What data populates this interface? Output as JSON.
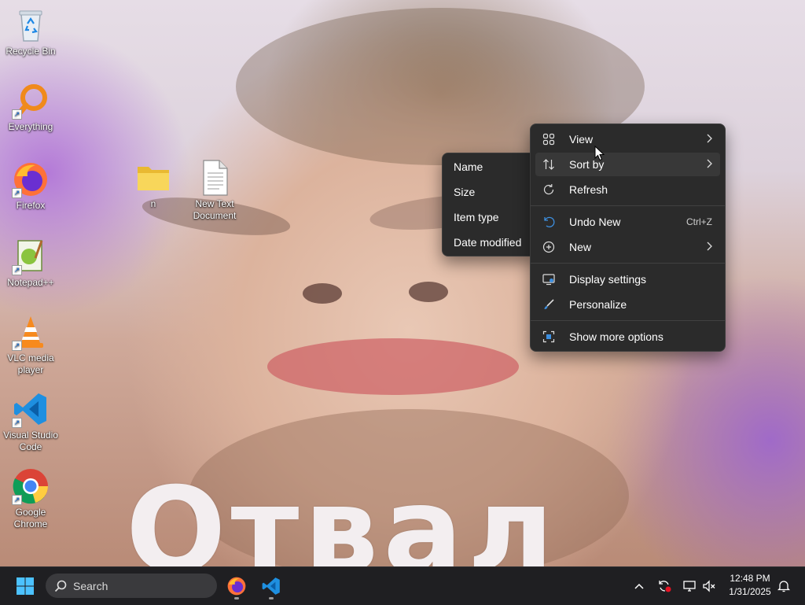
{
  "desktop": {
    "icons": [
      {
        "label": "Recycle Bin"
      },
      {
        "label": "Everything"
      },
      {
        "label": "Firefox"
      },
      {
        "label": "Notepad++"
      },
      {
        "label": "VLC media player"
      },
      {
        "label": "Visual Studio Code"
      },
      {
        "label": "Google Chrome"
      },
      {
        "label": "n"
      },
      {
        "label": "New Text Document"
      }
    ]
  },
  "wallpaper": {
    "caption": "Отвал"
  },
  "context_menu": {
    "items": {
      "view": "View",
      "sort_by": "Sort by",
      "refresh": "Refresh",
      "undo_new": "Undo New",
      "undo_shortcut": "Ctrl+Z",
      "new": "New",
      "display_settings": "Display settings",
      "personalize": "Personalize",
      "show_more": "Show more options"
    }
  },
  "sort_submenu": {
    "items": [
      "Name",
      "Size",
      "Item type",
      "Date modified"
    ]
  },
  "taskbar": {
    "search_placeholder": "Search",
    "time": "12:48 PM",
    "date": "1/31/2025"
  },
  "colors": {
    "menu_bg": "#2b2b2b",
    "taskbar_bg": "#1f1f22",
    "accent": "#0078d4"
  }
}
